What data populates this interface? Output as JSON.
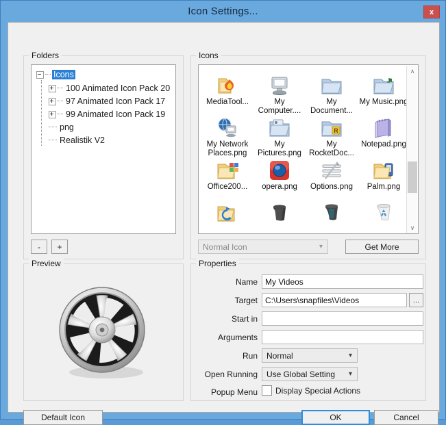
{
  "window": {
    "title": "Icon Settings...",
    "close_label": "x",
    "accent_color": "#6aa9de",
    "close_color": "#c9504f"
  },
  "folders": {
    "group_label": "Folders",
    "tree": [
      {
        "label": "Icons",
        "expander": "minus",
        "selected": true,
        "depth": 0
      },
      {
        "label": "100 Animated Icon Pack  20",
        "expander": "plus",
        "selected": false,
        "depth": 1
      },
      {
        "label": "97 Animated Icon Pack  17",
        "expander": "plus",
        "selected": false,
        "depth": 1
      },
      {
        "label": "99 Animated Icon Pack  19",
        "expander": "plus",
        "selected": false,
        "depth": 1
      },
      {
        "label": "png",
        "expander": "none",
        "selected": false,
        "depth": 1
      },
      {
        "label": "Realistik V2",
        "expander": "none",
        "selected": false,
        "depth": 1
      }
    ],
    "remove_label": "-",
    "add_label": "+"
  },
  "icons": {
    "group_label": "Icons",
    "items": [
      {
        "caption": "MediaTool...",
        "icon": "folder-flame-icon"
      },
      {
        "caption": "My Computer....",
        "icon": "my-computer-icon"
      },
      {
        "caption": "My Document...",
        "icon": "folder-documents-icon"
      },
      {
        "caption": "My Music.png",
        "icon": "folder-music-icon"
      },
      {
        "caption": "My Network Places.png",
        "icon": "network-globe-icon"
      },
      {
        "caption": "My Pictures.png",
        "icon": "folder-pictures-icon"
      },
      {
        "caption": "My RocketDoc...",
        "icon": "folder-rocketdock-icon"
      },
      {
        "caption": "Notepad.png",
        "icon": "notepad-icon"
      },
      {
        "caption": "Office200...",
        "icon": "folder-office-icon"
      },
      {
        "caption": "opera.png",
        "icon": "opera-icon"
      },
      {
        "caption": "Options.png",
        "icon": "options-sliders-icon"
      },
      {
        "caption": "Palm.png",
        "icon": "folder-palm-icon"
      },
      {
        "caption": "",
        "icon": "folder-refresh-icon"
      },
      {
        "caption": "",
        "icon": "trash-black-icon"
      },
      {
        "caption": "",
        "icon": "trash-dark-icon"
      },
      {
        "caption": "",
        "icon": "recycle-bin-icon"
      }
    ],
    "icon_type": "Normal Icon",
    "get_more_label": "Get More",
    "scroll_up": "∧",
    "scroll_down": "∨"
  },
  "preview": {
    "group_label": "Preview",
    "image": "film-reel-icon"
  },
  "properties": {
    "group_label": "Properties",
    "fields": [
      {
        "label": "Name",
        "value": "My Videos",
        "type": "text"
      },
      {
        "label": "Target",
        "value": "C:\\Users\\snapfiles\\Videos",
        "type": "text-browse"
      },
      {
        "label": "Start in",
        "value": "",
        "type": "text"
      },
      {
        "label": "Arguments",
        "value": "",
        "type": "text"
      },
      {
        "label": "Run",
        "value": "Normal",
        "type": "select"
      },
      {
        "label": "Open Running",
        "value": "Use Global Setting",
        "type": "select"
      },
      {
        "label": "Popup Menu",
        "value": "Display Special Actions",
        "type": "checkbox",
        "checked": false
      }
    ],
    "browse_label": "..."
  },
  "buttons": {
    "default_icon": "Default Icon",
    "ok": "OK",
    "cancel": "Cancel"
  }
}
